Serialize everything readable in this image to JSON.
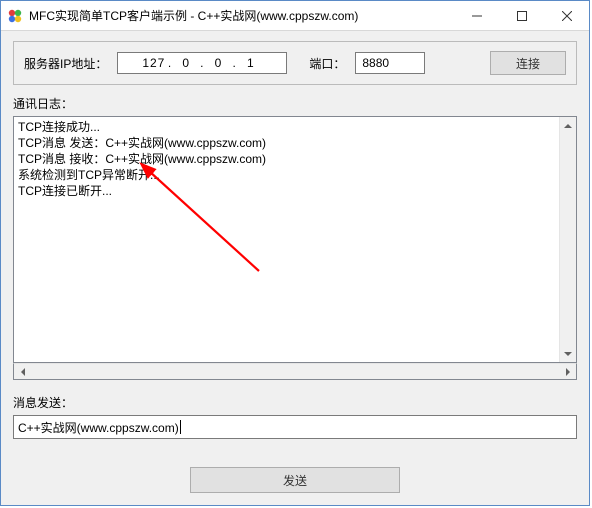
{
  "window": {
    "title": "MFC实现简单TCP客户端示例 - C++实战网(www.cppszw.com)"
  },
  "conn": {
    "ip_label": "服务器IP地址：",
    "ip_octets": [
      "127",
      "0",
      "0",
      "1"
    ],
    "port_label": "端口：",
    "port_value": "8880",
    "connect_label": "连接"
  },
  "log": {
    "label": "通讯日志：",
    "lines": [
      "TCP连接成功...",
      "TCP消息 发送：C++实战网(www.cppszw.com)",
      "TCP消息 接收：C++实战网(www.cppszw.com)",
      "系统检测到TCP异常断开...",
      "TCP连接已断开..."
    ]
  },
  "send": {
    "label": "消息发送：",
    "value": "C++实战网(www.cppszw.com)",
    "button_label": "发送"
  },
  "icon_colors": {
    "ball1": "#e23c3c",
    "ball2": "#3cb44b",
    "ball3": "#3c6fe2",
    "ball4": "#f0c020"
  },
  "annotation": {
    "color": "#ff0000"
  }
}
